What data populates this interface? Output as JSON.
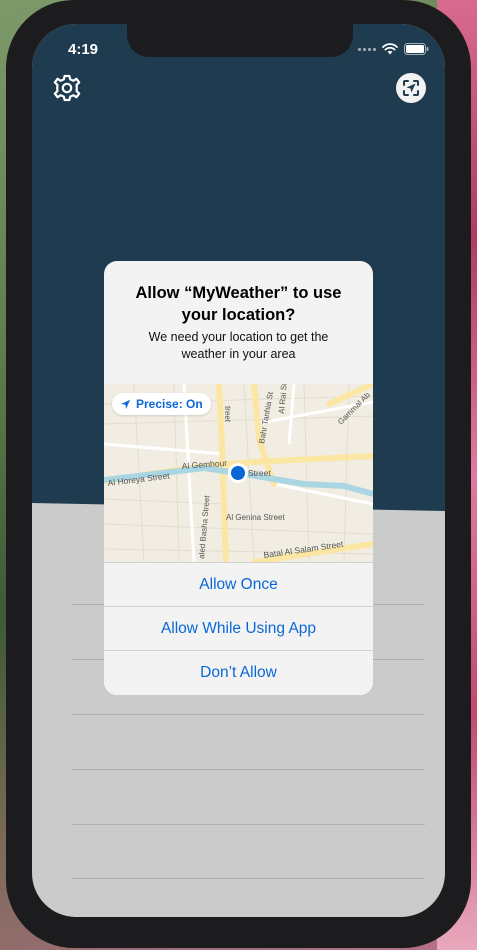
{
  "status_bar": {
    "time": "4:19"
  },
  "toolbar": {
    "left_icon": "gear-icon",
    "right_icon": "location-scan-icon"
  },
  "dialog": {
    "title": "Allow “MyWeather” to use your location?",
    "message": "We need your location to get the weather in your area",
    "precise_label": "Precise: On",
    "map_labels": {
      "street_1": "Al Gemhour",
      "street_1b": "Street",
      "street_2": "Al Horeya Street",
      "street_3": "Al Genina Street",
      "street_4": "Batal Al Salam Street",
      "street_5": "aled Basha Street",
      "street_6": "Bahr Tanhia St",
      "street_7": "Al Rai St",
      "street_8": "Gammal Ab",
      "street_9": "treet"
    },
    "buttons": {
      "allow_once": "Allow Once",
      "allow_while_using": "Allow While Using App",
      "dont_allow": "Don’t Allow"
    }
  },
  "colors": {
    "header": "#1f3b50",
    "content_bg": "#cbcbcb",
    "accent": "#0a68d6"
  }
}
